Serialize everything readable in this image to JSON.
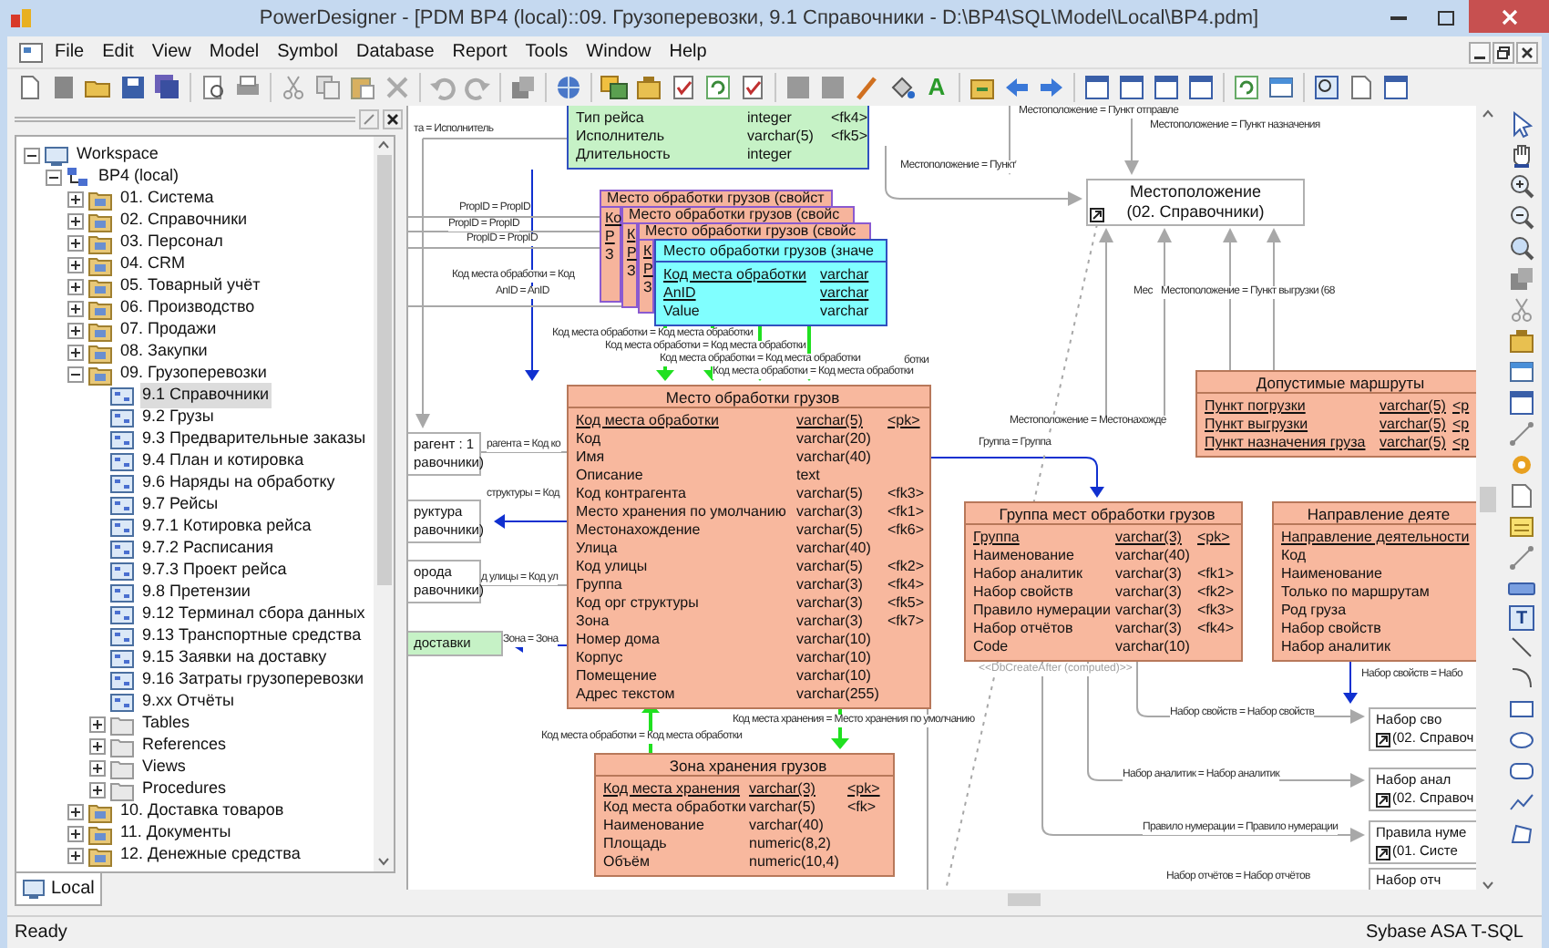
{
  "window": {
    "title": "PowerDesigner - [PDM BP4 (local)::09. Грузоперевозки, 9.1 Справочники - D:\\BP4\\SQL\\Model\\Local\\BP4.pdm]"
  },
  "menu": [
    "File",
    "Edit",
    "View",
    "Model",
    "Symbol",
    "Database",
    "Report",
    "Tools",
    "Window",
    "Help"
  ],
  "toolbar": {
    "font_color_glyph": "A"
  },
  "browser": {
    "tab": "Local",
    "tree": [
      {
        "label": "Workspace",
        "kind": "workspace",
        "expanded": true,
        "selected": false,
        "children": [
          {
            "label": "BP4 (local)",
            "kind": "model",
            "expanded": true,
            "selected": false,
            "children": [
              {
                "label": "01. Система",
                "kind": "package",
                "expanded": false,
                "selected": false
              },
              {
                "label": "02. Справочники",
                "kind": "package",
                "expanded": false,
                "selected": false
              },
              {
                "label": "03. Персонал",
                "kind": "package",
                "expanded": false,
                "selected": false
              },
              {
                "label": "04. CRM",
                "kind": "package",
                "expanded": false,
                "selected": false
              },
              {
                "label": "05. Товарный учёт",
                "kind": "package",
                "expanded": false,
                "selected": false
              },
              {
                "label": "06. Производство",
                "kind": "package",
                "expanded": false,
                "selected": false
              },
              {
                "label": "07. Продажи",
                "kind": "package",
                "expanded": false,
                "selected": false
              },
              {
                "label": "08. Закупки",
                "kind": "package",
                "expanded": false,
                "selected": false
              },
              {
                "label": "09. Грузоперевозки",
                "kind": "package",
                "expanded": true,
                "selected": false,
                "children": [
                  {
                    "label": "9.1 Справочники",
                    "kind": "diagram",
                    "selected": true
                  },
                  {
                    "label": "9.2 Грузы",
                    "kind": "diagram",
                    "selected": false
                  },
                  {
                    "label": "9.3 Предварительные заказы",
                    "kind": "diagram",
                    "selected": false
                  },
                  {
                    "label": "9.4 План и котировка",
                    "kind": "diagram",
                    "selected": false
                  },
                  {
                    "label": "9.6 Наряды на обработку",
                    "kind": "diagram",
                    "selected": false
                  },
                  {
                    "label": "9.7 Рейсы",
                    "kind": "diagram",
                    "selected": false
                  },
                  {
                    "label": "9.7.1 Котировка рейса",
                    "kind": "diagram",
                    "selected": false
                  },
                  {
                    "label": "9.7.2 Расписания",
                    "kind": "diagram",
                    "selected": false
                  },
                  {
                    "label": "9.7.3 Проект рейса",
                    "kind": "diagram",
                    "selected": false
                  },
                  {
                    "label": "9.8 Претензии",
                    "kind": "diagram",
                    "selected": false
                  },
                  {
                    "label": "9.12 Терминал сбора данных",
                    "kind": "diagram",
                    "selected": false
                  },
                  {
                    "label": "9.13 Транспортные средства",
                    "kind": "diagram",
                    "selected": false
                  },
                  {
                    "label": "9.15 Заявки на доставку",
                    "kind": "diagram",
                    "selected": false
                  },
                  {
                    "label": "9.16 Затраты грузоперевозки",
                    "kind": "diagram",
                    "selected": false
                  },
                  {
                    "label": "9.xx Отчёты",
                    "kind": "diagram",
                    "selected": false
                  },
                  {
                    "label": "Tables",
                    "kind": "folder",
                    "expanded": false,
                    "selected": false
                  },
                  {
                    "label": "References",
                    "kind": "folder",
                    "expanded": false,
                    "selected": false
                  },
                  {
                    "label": "Views",
                    "kind": "folder",
                    "expanded": false,
                    "selected": false
                  },
                  {
                    "label": "Procedures",
                    "kind": "folder",
                    "expanded": false,
                    "selected": false
                  }
                ]
              },
              {
                "label": "10. Доставка товаров",
                "kind": "package",
                "expanded": false,
                "selected": false
              },
              {
                "label": "11. Документы",
                "kind": "package",
                "expanded": false,
                "selected": false
              },
              {
                "label": "12. Денежные средства",
                "kind": "package",
                "expanded": false,
                "selected": false
              }
            ]
          }
        ]
      }
    ]
  },
  "diagram": {
    "tables": [
      {
        "color": "#c6f2c6",
        "rows": [
          {
            "name": "Тип рейса",
            "type": "integer",
            "key": "<fk4>",
            "primary": false
          },
          {
            "name": "Исполнитель",
            "type": "varchar(5)",
            "key": "<fk5>",
            "primary": false
          },
          {
            "name": "Длительность",
            "type": "integer",
            "primary": false
          }
        ]
      },
      {
        "title": "Место обработки грузов (свойст",
        "color": "#f6b49c",
        "rows": [
          {
            "name": "Ко",
            "primary": true
          },
          {
            "name": "Р",
            "primary": true
          },
          {
            "name": "З",
            "primary": false
          }
        ]
      },
      {
        "title": "Место обработки грузов (свойс",
        "color": "#f6b49c",
        "rows": [
          {
            "name": "К",
            "primary": true
          },
          {
            "name": "Р",
            "primary": true
          },
          {
            "name": "З",
            "primary": false
          }
        ]
      },
      {
        "title": "Место обработки грузов (свойс",
        "color": "#f6b49c",
        "rows": [
          {
            "name": "К",
            "primary": true
          },
          {
            "name": "Р",
            "primary": true
          },
          {
            "name": "З",
            "primary": false
          }
        ]
      },
      {
        "title": "Место обработки грузов (значе",
        "color": "#80ffff",
        "rows": [
          {
            "name": "Код места обработки",
            "type": "varchar",
            "primary": true
          },
          {
            "name": "AnID",
            "type": "varchar",
            "primary": true
          },
          {
            "name": "Value",
            "type": "varchar",
            "primary": false
          }
        ]
      },
      {
        "title": "Место обработки грузов",
        "color": "#f8b89e",
        "rows": [
          {
            "name": "Код места обработки",
            "type": "varchar(5)",
            "key": "<pk>",
            "primary": true
          },
          {
            "name": "Код",
            "type": "varchar(20)",
            "primary": false
          },
          {
            "name": "Имя",
            "type": "varchar(40)",
            "primary": false
          },
          {
            "name": "Описание",
            "type": "text",
            "primary": false
          },
          {
            "name": "Код контрагента",
            "type": "varchar(5)",
            "key": "<fk3>",
            "primary": false
          },
          {
            "name": "Место хранения по умолчанию",
            "type": "varchar(3)",
            "key": "<fk1>",
            "primary": false
          },
          {
            "name": "Местонахождение",
            "type": "varchar(5)",
            "key": "<fk6>",
            "primary": false
          },
          {
            "name": "Улица",
            "type": "varchar(40)",
            "primary": false
          },
          {
            "name": "Код улицы",
            "type": "varchar(5)",
            "key": "<fk2>",
            "primary": false
          },
          {
            "name": "Группа",
            "type": "varchar(3)",
            "key": "<fk4>",
            "primary": false
          },
          {
            "name": "Код орг структуры",
            "type": "varchar(3)",
            "key": "<fk5>",
            "primary": false
          },
          {
            "name": "Зона",
            "type": "varchar(3)",
            "key": "<fk7>",
            "primary": false
          },
          {
            "name": "Номер дома",
            "type": "varchar(10)",
            "primary": false
          },
          {
            "name": "Корпус",
            "type": "varchar(10)",
            "primary": false
          },
          {
            "name": "Помещение",
            "type": "varchar(10)",
            "primary": false
          },
          {
            "name": "Адрес текстом",
            "type": "varchar(255)",
            "primary": false
          }
        ]
      },
      {
        "title": "Допустимые маршруты",
        "color": "#f8b89e",
        "rows": [
          {
            "name": "Пункт погрузки",
            "type": "varchar(5)",
            "key": "<p",
            "primary": true
          },
          {
            "name": "Пункт выгрузки",
            "type": "varchar(5)",
            "key": "<p",
            "primary": true
          },
          {
            "name": "Пункт назначения груза",
            "type": "varchar(5)",
            "key": "<p",
            "primary": true
          }
        ]
      },
      {
        "title": "Группа мест обработки грузов",
        "color": "#f8b89e",
        "note": "<<DbCreateAfter (computed)>>",
        "rows": [
          {
            "name": "Группа",
            "type": "varchar(3)",
            "key": "<pk>",
            "primary": true
          },
          {
            "name": "Наименование",
            "type": "varchar(40)",
            "primary": false
          },
          {
            "name": "Набор аналитик",
            "type": "varchar(3)",
            "key": "<fk1>",
            "primary": false
          },
          {
            "name": "Набор свойств",
            "type": "varchar(3)",
            "key": "<fk2>",
            "primary": false
          },
          {
            "name": "Правило нумерации",
            "type": "varchar(3)",
            "key": "<fk3>",
            "primary": false
          },
          {
            "name": "Набор отчётов",
            "type": "varchar(3)",
            "key": "<fk4>",
            "primary": false
          },
          {
            "name": "Code",
            "type": "varchar(10)",
            "primary": false
          }
        ]
      },
      {
        "title": "Направление деяте",
        "color": "#f8b89e",
        "rows": [
          {
            "name": "Направление деятельности",
            "primary": true
          },
          {
            "name": "Код",
            "primary": false
          },
          {
            "name": "Наименование",
            "primary": false
          },
          {
            "name": "Только по маршрутам",
            "primary": false
          },
          {
            "name": "Род груза",
            "primary": false
          },
          {
            "name": "Набор свойств",
            "primary": false
          },
          {
            "name": "Набор аналитик",
            "primary": false
          }
        ]
      },
      {
        "title": "Зона хранения грузов",
        "color": "#f8b89e",
        "rows": [
          {
            "name": "Код места хранения",
            "type": "varchar(3)",
            "key": "<pk>",
            "primary": true
          },
          {
            "name": "Код места обработки",
            "type": "varchar(5)",
            "key": "<fk>",
            "primary": false
          },
          {
            "name": "Наименование",
            "type": "varchar(40)",
            "primary": false
          },
          {
            "name": "Площадь",
            "type": "numeric(8,2)",
            "primary": false
          },
          {
            "name": "Объём",
            "type": "numeric(10,4)",
            "primary": false
          }
        ]
      }
    ],
    "shortcuts": [
      {
        "lines": [
          "Местоположение",
          "(02. Справочники)"
        ],
        "kind": "reference",
        "color": "#ffffff"
      },
      {
        "lines": [
          "рагент : 1",
          "равочники)"
        ],
        "kind": "partial",
        "color": "#ffffff"
      },
      {
        "lines": [
          "руктура",
          "равочники)"
        ],
        "kind": "partial",
        "color": "#ffffff"
      },
      {
        "lines": [
          "орода",
          "равочники)"
        ],
        "kind": "partial",
        "color": "#ffffff"
      },
      {
        "lines": [
          "доставки"
        ],
        "kind": "partial",
        "color": "#c6f2c6"
      },
      {
        "lines": [
          "Набор сво",
          "(02. Справоч"
        ],
        "kind": "reference",
        "color": "#ffffff"
      },
      {
        "lines": [
          "Набор анал",
          "(02. Справоч"
        ],
        "kind": "reference",
        "color": "#ffffff"
      },
      {
        "lines": [
          "Правила нуме",
          "(01. Систе"
        ],
        "kind": "reference",
        "color": "#ffffff"
      },
      {
        "lines": [
          "Набор отч"
        ],
        "kind": "partial",
        "color": "#ffffff"
      }
    ],
    "labels": [
      "Местоположение = Пункт отправле",
      "та = Исполнитель",
      "Местоположение = Пункт назначения",
      "Местоположение = Пункт",
      "PropID = PropID",
      "PropID = PropID",
      "PropID = PropID",
      "Код места обработки = Код",
      "AnID = AnID",
      "Мес",
      "Местоположение = Пункт выгрузки (68",
      "Код места обработки = Код места обработки",
      "Код места обработки = Код места обработки",
      "Код места обработки = Код места обработки",
      "ботки",
      "Код места обработки = Код места обработки",
      "Местоположение = Местонахожде",
      "рагента = Код ко",
      "Группа = Группа",
      "структуры = Код",
      "д улицы = Код ул",
      "Зона = Зона",
      "Набор свойств = Набо",
      "Код места хранения = Место хранения по умолчанию",
      "Набор свойств = Набор свойств",
      "Код места обработки = Код места обработки",
      "Набор аналитик = Набор аналитик",
      "Правило нумерации = Правило нумерации",
      "Набор отчётов = Набор отчётов"
    ]
  },
  "palette": {
    "text_tool_glyph": "T"
  },
  "status_bar": {
    "left": "Ready",
    "right": "Sybase ASA T-SQL"
  }
}
